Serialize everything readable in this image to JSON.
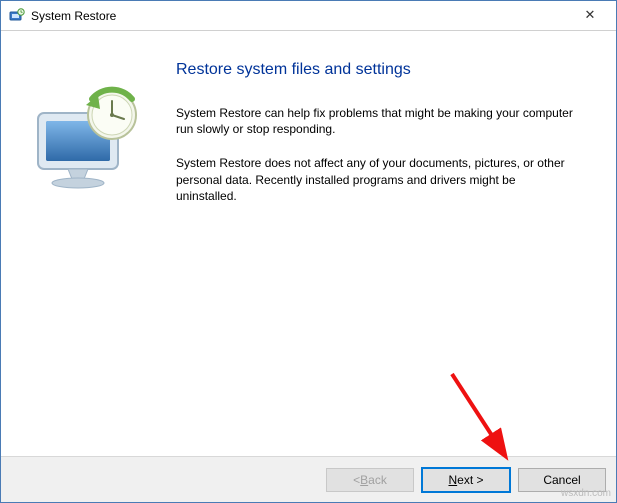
{
  "window": {
    "title": "System Restore",
    "icon": "system-restore-icon",
    "close": "✕"
  },
  "content": {
    "heading": "Restore system files and settings",
    "paragraph1": "System Restore can help fix problems that might be making your computer run slowly or stop responding.",
    "paragraph2": "System Restore does not affect any of your documents, pictures, or other personal data. Recently installed programs and drivers might be uninstalled."
  },
  "buttons": {
    "back_prefix": "< ",
    "back_mnemonic": "B",
    "back_suffix": "ack",
    "next_mnemonic": "N",
    "next_suffix": "ext >",
    "cancel": "Cancel"
  },
  "watermark": "wsxdn.com"
}
